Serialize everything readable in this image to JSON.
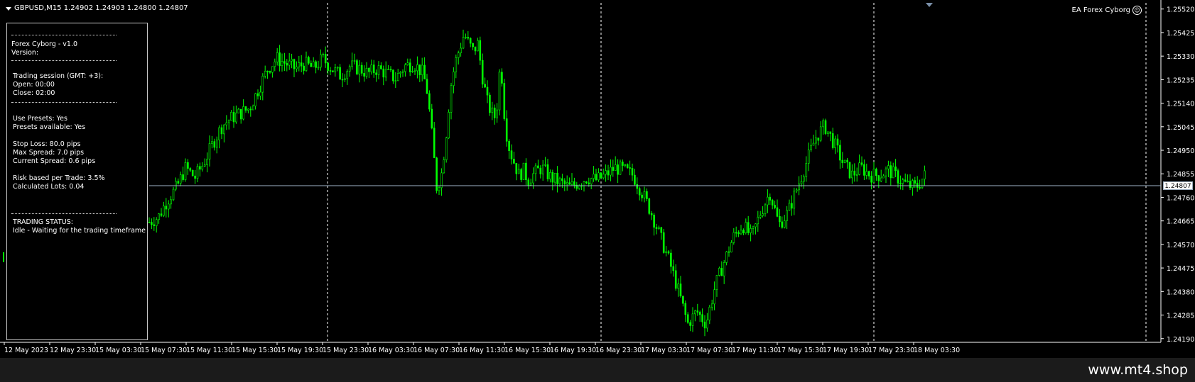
{
  "chart": {
    "header": "GBPUSD,M15  1.24902 1.24903 1.24800 1.24807",
    "ea_label": "EA Forex Cyborg",
    "current_price": "1.24807",
    "price_axis": [
      "1.25520",
      "1.25425",
      "1.25330",
      "1.25235",
      "1.25140",
      "1.25045",
      "1.24950",
      "1.24855",
      "1.24760",
      "1.24665",
      "1.24570",
      "1.24475",
      "1.24380",
      "1.24285",
      "1.24190"
    ],
    "time_axis": [
      "12 May 2023",
      "12 May 23:30",
      "15 May 03:30",
      "15 May 07:30",
      "15 May 11:30",
      "15 May 15:30",
      "15 May 19:30",
      "15 May 23:30",
      "16 May 03:30",
      "16 May 07:30",
      "16 May 11:30",
      "16 May 15:30",
      "16 May 19:30",
      "16 May 23:30",
      "17 May 03:30",
      "17 May 07:30",
      "17 May 11:30",
      "17 May 15:30",
      "17 May 19:30",
      "17 May 23:30",
      "18 May 03:30"
    ],
    "candle_color": "#00ff00"
  },
  "panel": {
    "title": "Forex Cyborg - v1.0",
    "version": "Version:",
    "session": "Trading session (GMT: +3):",
    "open": "Open:   00:00",
    "close": "Close:  02:00",
    "use_presets": "Use Presets: Yes",
    "presets_available": "Presets available: Yes",
    "stop_loss": "Stop Loss: 80.0 pips",
    "max_spread": "Max Spread: 7.0 pips",
    "current_spread": "Current Spread: 0.6 pips",
    "risk": "Risk based per Trade: 3.5%",
    "lots": "Calculated Lots: 0.04",
    "status_title": "TRADING STATUS:",
    "status": "Idle - Waiting for the trading timeframe"
  },
  "footer": {
    "brand": "www.mt4.shop"
  },
  "chart_data": {
    "type": "candlestick",
    "symbol": "GBPUSD",
    "timeframe": "M15",
    "ohlc_last": {
      "open": 1.24902,
      "high": 1.24903,
      "low": 1.248,
      "close": 1.24807
    },
    "ylim": [
      1.24175,
      1.25545
    ],
    "close_path": [
      [
        0,
        1.2466
      ],
      [
        2,
        1.2468
      ],
      [
        4,
        1.2475
      ],
      [
        6,
        1.248
      ],
      [
        8,
        1.2488
      ],
      [
        10,
        1.2484
      ],
      [
        12,
        1.249
      ],
      [
        14,
        1.2498
      ],
      [
        16,
        1.2505
      ],
      [
        18,
        1.2508
      ],
      [
        20,
        1.251
      ],
      [
        22,
        1.2512
      ],
      [
        24,
        1.252
      ],
      [
        26,
        1.2528
      ],
      [
        28,
        1.2532
      ],
      [
        30,
        1.253
      ],
      [
        32,
        1.2528
      ],
      [
        34,
        1.253
      ],
      [
        36,
        1.2528
      ],
      [
        38,
        1.2532
      ],
      [
        40,
        1.2528
      ],
      [
        42,
        1.2525
      ],
      [
        44,
        1.2529
      ],
      [
        46,
        1.2528
      ],
      [
        48,
        1.2526
      ],
      [
        50,
        1.2528
      ],
      [
        52,
        1.2526
      ],
      [
        54,
        1.2524
      ],
      [
        56,
        1.2529
      ],
      [
        58,
        1.253
      ],
      [
        60,
        1.2526
      ],
      [
        61,
        1.2518
      ],
      [
        62,
        1.25
      ],
      [
        63,
        1.248
      ],
      [
        64,
        1.2485
      ],
      [
        65,
        1.25
      ],
      [
        66,
        1.252
      ],
      [
        67,
        1.253
      ],
      [
        68,
        1.2536
      ],
      [
        69,
        1.2542
      ],
      [
        70,
        1.2538
      ],
      [
        71,
        1.2535
      ],
      [
        72,
        1.2538
      ],
      [
        73,
        1.2525
      ],
      [
        74,
        1.2515
      ],
      [
        75,
        1.251
      ],
      [
        76,
        1.2508
      ],
      [
        77,
        1.2532
      ],
      [
        78,
        1.2505
      ],
      [
        79,
        1.2495
      ],
      [
        80,
        1.249
      ],
      [
        81,
        1.2485
      ],
      [
        82,
        1.2487
      ],
      [
        83,
        1.2483
      ],
      [
        84,
        1.2485
      ],
      [
        86,
        1.2488
      ],
      [
        88,
        1.2484
      ],
      [
        90,
        1.2482
      ],
      [
        92,
        1.248
      ],
      [
        94,
        1.2482
      ],
      [
        96,
        1.2484
      ],
      [
        98,
        1.2483
      ],
      [
        100,
        1.2485
      ],
      [
        102,
        1.2488
      ],
      [
        104,
        1.2487
      ],
      [
        106,
        1.2485
      ],
      [
        108,
        1.2478
      ],
      [
        110,
        1.247
      ],
      [
        112,
        1.246
      ],
      [
        114,
        1.245
      ],
      [
        116,
        1.2438
      ],
      [
        118,
        1.2425
      ],
      [
        120,
        1.243
      ],
      [
        122,
        1.2425
      ],
      [
        124,
        1.244
      ],
      [
        126,
        1.245
      ],
      [
        128,
        1.246
      ],
      [
        130,
        1.2465
      ],
      [
        132,
        1.246
      ],
      [
        134,
        1.247
      ],
      [
        136,
        1.2478
      ],
      [
        138,
        1.2465
      ],
      [
        140,
        1.247
      ],
      [
        142,
        1.248
      ],
      [
        144,
        1.249
      ],
      [
        146,
        1.25
      ],
      [
        148,
        1.2505
      ],
      [
        150,
        1.2498
      ],
      [
        152,
        1.249
      ],
      [
        154,
        1.2485
      ],
      [
        156,
        1.2488
      ],
      [
        158,
        1.2485
      ],
      [
        160,
        1.2485
      ],
      [
        162,
        1.2487
      ],
      [
        164,
        1.2484
      ],
      [
        166,
        1.2481
      ],
      [
        168,
        1.248
      ],
      [
        170,
        1.2485
      ]
    ]
  }
}
